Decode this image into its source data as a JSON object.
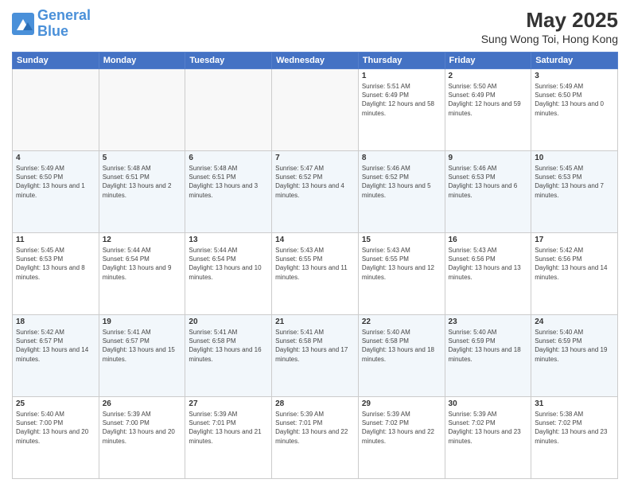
{
  "header": {
    "logo_line1": "General",
    "logo_line2": "Blue",
    "month": "May 2025",
    "location": "Sung Wong Toi, Hong Kong"
  },
  "weekdays": [
    "Sunday",
    "Monday",
    "Tuesday",
    "Wednesday",
    "Thursday",
    "Friday",
    "Saturday"
  ],
  "weeks": [
    [
      {
        "day": "",
        "info": ""
      },
      {
        "day": "",
        "info": ""
      },
      {
        "day": "",
        "info": ""
      },
      {
        "day": "",
        "info": ""
      },
      {
        "day": "1",
        "info": "Sunrise: 5:51 AM\nSunset: 6:49 PM\nDaylight: 12 hours and 58 minutes."
      },
      {
        "day": "2",
        "info": "Sunrise: 5:50 AM\nSunset: 6:49 PM\nDaylight: 12 hours and 59 minutes."
      },
      {
        "day": "3",
        "info": "Sunrise: 5:49 AM\nSunset: 6:50 PM\nDaylight: 13 hours and 0 minutes."
      }
    ],
    [
      {
        "day": "4",
        "info": "Sunrise: 5:49 AM\nSunset: 6:50 PM\nDaylight: 13 hours and 1 minute."
      },
      {
        "day": "5",
        "info": "Sunrise: 5:48 AM\nSunset: 6:51 PM\nDaylight: 13 hours and 2 minutes."
      },
      {
        "day": "6",
        "info": "Sunrise: 5:48 AM\nSunset: 6:51 PM\nDaylight: 13 hours and 3 minutes."
      },
      {
        "day": "7",
        "info": "Sunrise: 5:47 AM\nSunset: 6:52 PM\nDaylight: 13 hours and 4 minutes."
      },
      {
        "day": "8",
        "info": "Sunrise: 5:46 AM\nSunset: 6:52 PM\nDaylight: 13 hours and 5 minutes."
      },
      {
        "day": "9",
        "info": "Sunrise: 5:46 AM\nSunset: 6:53 PM\nDaylight: 13 hours and 6 minutes."
      },
      {
        "day": "10",
        "info": "Sunrise: 5:45 AM\nSunset: 6:53 PM\nDaylight: 13 hours and 7 minutes."
      }
    ],
    [
      {
        "day": "11",
        "info": "Sunrise: 5:45 AM\nSunset: 6:53 PM\nDaylight: 13 hours and 8 minutes."
      },
      {
        "day": "12",
        "info": "Sunrise: 5:44 AM\nSunset: 6:54 PM\nDaylight: 13 hours and 9 minutes."
      },
      {
        "day": "13",
        "info": "Sunrise: 5:44 AM\nSunset: 6:54 PM\nDaylight: 13 hours and 10 minutes."
      },
      {
        "day": "14",
        "info": "Sunrise: 5:43 AM\nSunset: 6:55 PM\nDaylight: 13 hours and 11 minutes."
      },
      {
        "day": "15",
        "info": "Sunrise: 5:43 AM\nSunset: 6:55 PM\nDaylight: 13 hours and 12 minutes."
      },
      {
        "day": "16",
        "info": "Sunrise: 5:43 AM\nSunset: 6:56 PM\nDaylight: 13 hours and 13 minutes."
      },
      {
        "day": "17",
        "info": "Sunrise: 5:42 AM\nSunset: 6:56 PM\nDaylight: 13 hours and 14 minutes."
      }
    ],
    [
      {
        "day": "18",
        "info": "Sunrise: 5:42 AM\nSunset: 6:57 PM\nDaylight: 13 hours and 14 minutes."
      },
      {
        "day": "19",
        "info": "Sunrise: 5:41 AM\nSunset: 6:57 PM\nDaylight: 13 hours and 15 minutes."
      },
      {
        "day": "20",
        "info": "Sunrise: 5:41 AM\nSunset: 6:58 PM\nDaylight: 13 hours and 16 minutes."
      },
      {
        "day": "21",
        "info": "Sunrise: 5:41 AM\nSunset: 6:58 PM\nDaylight: 13 hours and 17 minutes."
      },
      {
        "day": "22",
        "info": "Sunrise: 5:40 AM\nSunset: 6:58 PM\nDaylight: 13 hours and 18 minutes."
      },
      {
        "day": "23",
        "info": "Sunrise: 5:40 AM\nSunset: 6:59 PM\nDaylight: 13 hours and 18 minutes."
      },
      {
        "day": "24",
        "info": "Sunrise: 5:40 AM\nSunset: 6:59 PM\nDaylight: 13 hours and 19 minutes."
      }
    ],
    [
      {
        "day": "25",
        "info": "Sunrise: 5:40 AM\nSunset: 7:00 PM\nDaylight: 13 hours and 20 minutes."
      },
      {
        "day": "26",
        "info": "Sunrise: 5:39 AM\nSunset: 7:00 PM\nDaylight: 13 hours and 20 minutes."
      },
      {
        "day": "27",
        "info": "Sunrise: 5:39 AM\nSunset: 7:01 PM\nDaylight: 13 hours and 21 minutes."
      },
      {
        "day": "28",
        "info": "Sunrise: 5:39 AM\nSunset: 7:01 PM\nDaylight: 13 hours and 22 minutes."
      },
      {
        "day": "29",
        "info": "Sunrise: 5:39 AM\nSunset: 7:02 PM\nDaylight: 13 hours and 22 minutes."
      },
      {
        "day": "30",
        "info": "Sunrise: 5:39 AM\nSunset: 7:02 PM\nDaylight: 13 hours and 23 minutes."
      },
      {
        "day": "31",
        "info": "Sunrise: 5:38 AM\nSunset: 7:02 PM\nDaylight: 13 hours and 23 minutes."
      }
    ]
  ]
}
